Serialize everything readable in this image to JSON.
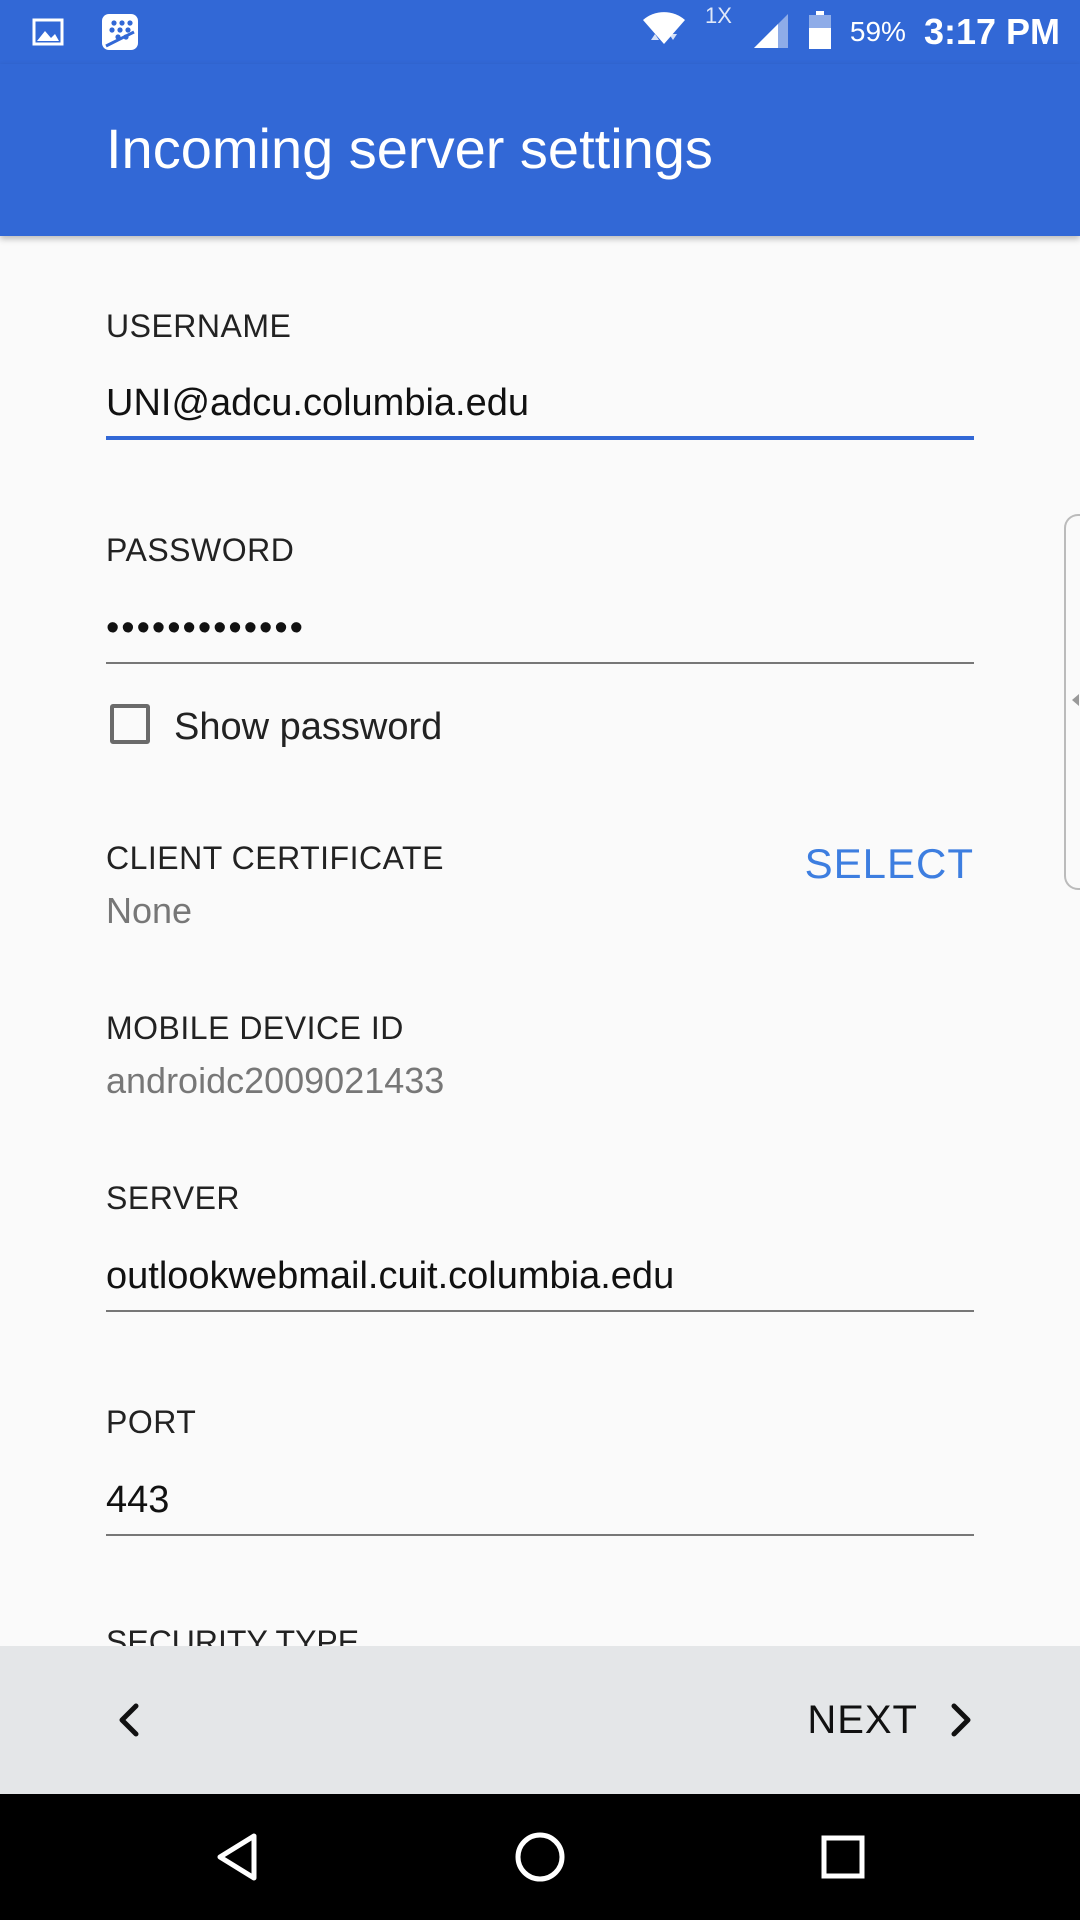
{
  "status_bar": {
    "network_label": "1X",
    "battery": "59%",
    "time": "3:17 PM"
  },
  "app_bar": {
    "title": "Incoming server settings"
  },
  "form": {
    "username": {
      "label": "USERNAME",
      "value": "UNI@adcu.columbia.edu"
    },
    "password": {
      "label": "PASSWORD",
      "value": "•••••••••••••"
    },
    "show_password": {
      "label": "Show password",
      "checked": false
    },
    "client_certificate": {
      "label": "CLIENT CERTIFICATE",
      "value": "None",
      "action": "SELECT"
    },
    "mobile_device_id": {
      "label": "MOBILE DEVICE ID",
      "value": "androidc2009021433"
    },
    "server": {
      "label": "SERVER",
      "value": "outlookwebmail.cuit.columbia.edu"
    },
    "port": {
      "label": "PORT",
      "value": "443"
    },
    "security_type": {
      "label": "SECURITY TYPE"
    }
  },
  "action_bar": {
    "next_label": "NEXT"
  },
  "colors": {
    "primary": "#3268d6",
    "accent": "#3d7ee0",
    "action_bar_bg": "#e4e6e8"
  },
  "icons": {
    "status_left": [
      "gallery-icon",
      "blackberry-icon"
    ],
    "status_right": [
      "wifi-icon",
      "signal-icon",
      "battery-icon"
    ],
    "nav": [
      "nav-back-icon",
      "nav-home-icon",
      "nav-recents-icon"
    ]
  }
}
